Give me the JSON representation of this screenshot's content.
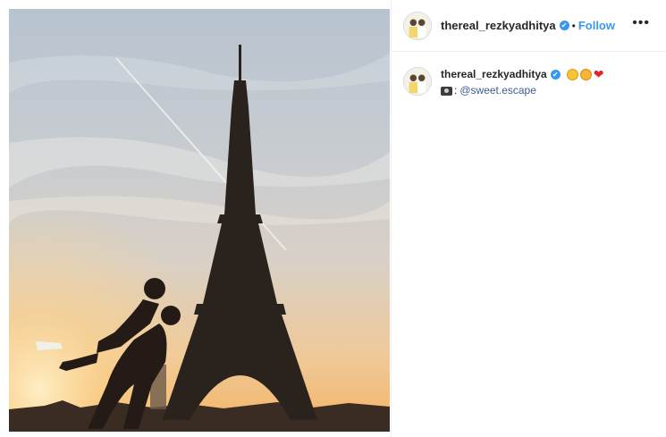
{
  "post": {
    "username": "thereal_rezkyadhitya",
    "verified_mark": "✔",
    "separator": "•",
    "follow_label": "Follow",
    "more_label": "•••"
  },
  "caption": {
    "username": "thereal_rezkyadhitya",
    "verified_mark": "✔",
    "emojis": [
      "grinning-face-icon",
      "smiling-face-with-hearts-icon",
      "red-heart-icon"
    ],
    "heart": "❤",
    "camera_icon": "movie-camera-icon",
    "colon": ":",
    "mention": "@sweet.escape"
  },
  "colors": {
    "accent": "#3897f0",
    "text": "#262626",
    "mention": "#3b5c8f",
    "heart": "#e0242c"
  }
}
